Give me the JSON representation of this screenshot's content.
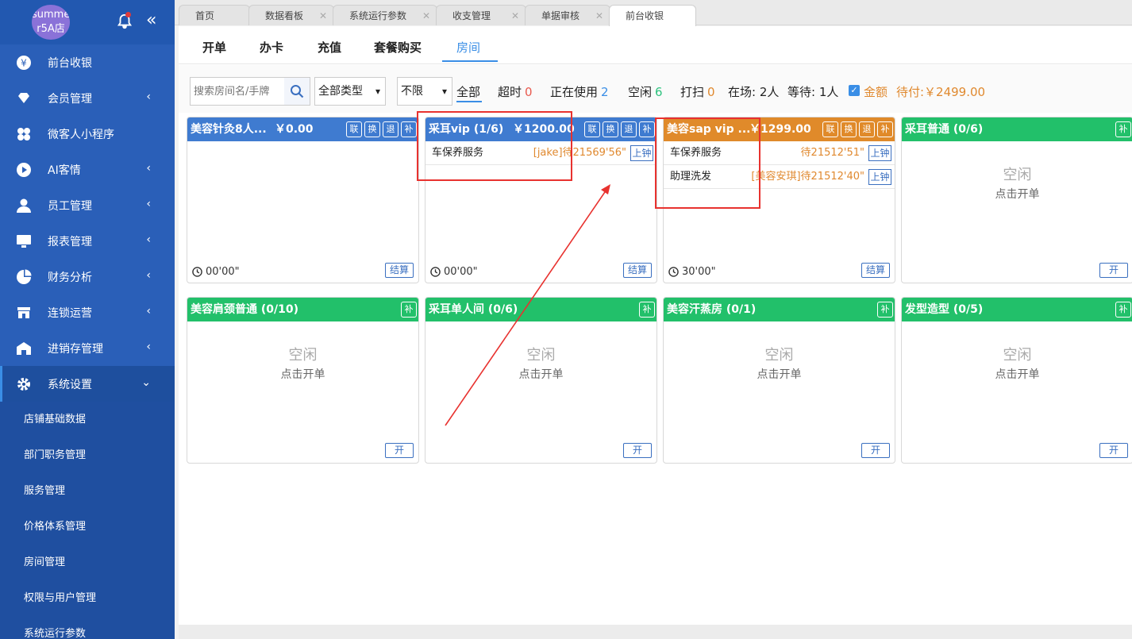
{
  "store": {
    "avatar_line1": "summe",
    "avatar_line2": "r5A店"
  },
  "sidebar": {
    "items": [
      {
        "label": "前台收银",
        "icon": "yen-icon",
        "has_arrow": false
      },
      {
        "label": "会员管理",
        "icon": "diamond-icon",
        "has_arrow": true
      },
      {
        "label": "微客人小程序",
        "icon": "clover-icon",
        "has_arrow": false
      },
      {
        "label": "AI客情",
        "icon": "play-circle-icon",
        "has_arrow": true
      },
      {
        "label": "员工管理",
        "icon": "user-icon",
        "has_arrow": true
      },
      {
        "label": "报表管理",
        "icon": "monitor-icon",
        "has_arrow": true
      },
      {
        "label": "财务分析",
        "icon": "pie-icon",
        "has_arrow": true
      },
      {
        "label": "连锁运营",
        "icon": "store-icon",
        "has_arrow": true
      },
      {
        "label": "进销存管理",
        "icon": "warehouse-icon",
        "has_arrow": true
      },
      {
        "label": "系统设置",
        "icon": "gear-icon",
        "has_arrow": true
      }
    ],
    "subitems": [
      "店铺基础数据",
      "部门职务管理",
      "服务管理",
      "价格体系管理",
      "房间管理",
      "权限与用户管理",
      "系统运行参数"
    ]
  },
  "tabs": [
    {
      "label": "首页",
      "closable": false
    },
    {
      "label": "数据看板",
      "closable": true
    },
    {
      "label": "系统运行参数",
      "closable": true
    },
    {
      "label": "收支管理",
      "closable": true
    },
    {
      "label": "单据审核",
      "closable": true
    },
    {
      "label": "前台收银",
      "closable": false
    }
  ],
  "subnav": [
    "开单",
    "办卡",
    "充值",
    "套餐购买",
    "房间"
  ],
  "filters": {
    "search_placeholder": "搜索房间名/手牌",
    "type_select": "全部类型",
    "limit_select": "不限",
    "all": "全部",
    "overtime": "超时",
    "overtime_count": "0",
    "in_use": "正在使用",
    "in_use_count": "2",
    "idle": "空闲",
    "idle_count": "6",
    "cleaning": "打扫",
    "cleaning_count": "0",
    "present": "在场: 2人",
    "waiting": "等待: 1人",
    "amount_label": "金额",
    "pending": "待付:￥2499.00"
  },
  "rooms": [
    {
      "name": "美容针灸8人...",
      "price": "￥0.00",
      "buttons": [
        "联",
        "换",
        "退",
        "补"
      ],
      "services": [],
      "time": "00'00\"",
      "action": "结算"
    },
    {
      "name": "采耳vip (1/6)",
      "price": "￥1200.00",
      "buttons": [
        "联",
        "换",
        "退",
        "补"
      ],
      "services": [
        {
          "name": "车保养服务",
          "info": "[jake]待21569'56\"",
          "btn": "上钟"
        }
      ],
      "time": "00'00\"",
      "action": "结算"
    },
    {
      "name": "美容sap vip ...",
      "price": "￥1299.00",
      "buttons": [
        "联",
        "换",
        "退",
        "补"
      ],
      "services": [
        {
          "name": "车保养服务",
          "info": "待21512'51\"",
          "btn": "上钟"
        },
        {
          "name": "助理洗发",
          "info": "[美容安琪]待21512'40\"",
          "btn": "上钟"
        }
      ],
      "time": "30'00\"",
      "action": "结算"
    },
    {
      "name": "采耳普通 (0/6)",
      "buttons": [
        "补"
      ],
      "idle_title": "空闲",
      "idle_sub": "点击开单",
      "action": "开"
    },
    {
      "name": "美容肩颈普通 (0/10)",
      "buttons": [
        "补"
      ],
      "idle_title": "空闲",
      "idle_sub": "点击开单",
      "action": "开"
    },
    {
      "name": "采耳单人间 (0/6)",
      "buttons": [
        "补"
      ],
      "idle_title": "空闲",
      "idle_sub": "点击开单",
      "action": "开"
    },
    {
      "name": "美容汗蒸房 (0/1)",
      "buttons": [
        "补"
      ],
      "idle_title": "空闲",
      "idle_sub": "点击开单",
      "action": "开"
    },
    {
      "name": "发型造型 (0/5)",
      "buttons": [
        "补"
      ],
      "idle_title": "空闲",
      "idle_sub": "点击开单",
      "action": "开"
    }
  ],
  "colors": {
    "sidebar": "#2a5fb8",
    "accent": "#3a8ee6",
    "in_use": "#3f7bd0",
    "overtime_warn": "#e08a2a",
    "idle": "#22c06a",
    "annotation": "#e8322f"
  }
}
